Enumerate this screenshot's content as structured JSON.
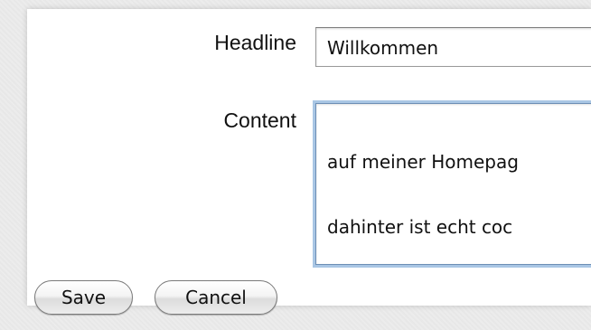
{
  "form": {
    "headline_label": "Headline",
    "headline_value": "Willkommen",
    "content_label": "Content",
    "content_line1": "auf meiner Homepag",
    "content_line2": "dahinter ist echt coc"
  },
  "buttons": {
    "save_label": "Save",
    "cancel_label": "Cancel"
  }
}
